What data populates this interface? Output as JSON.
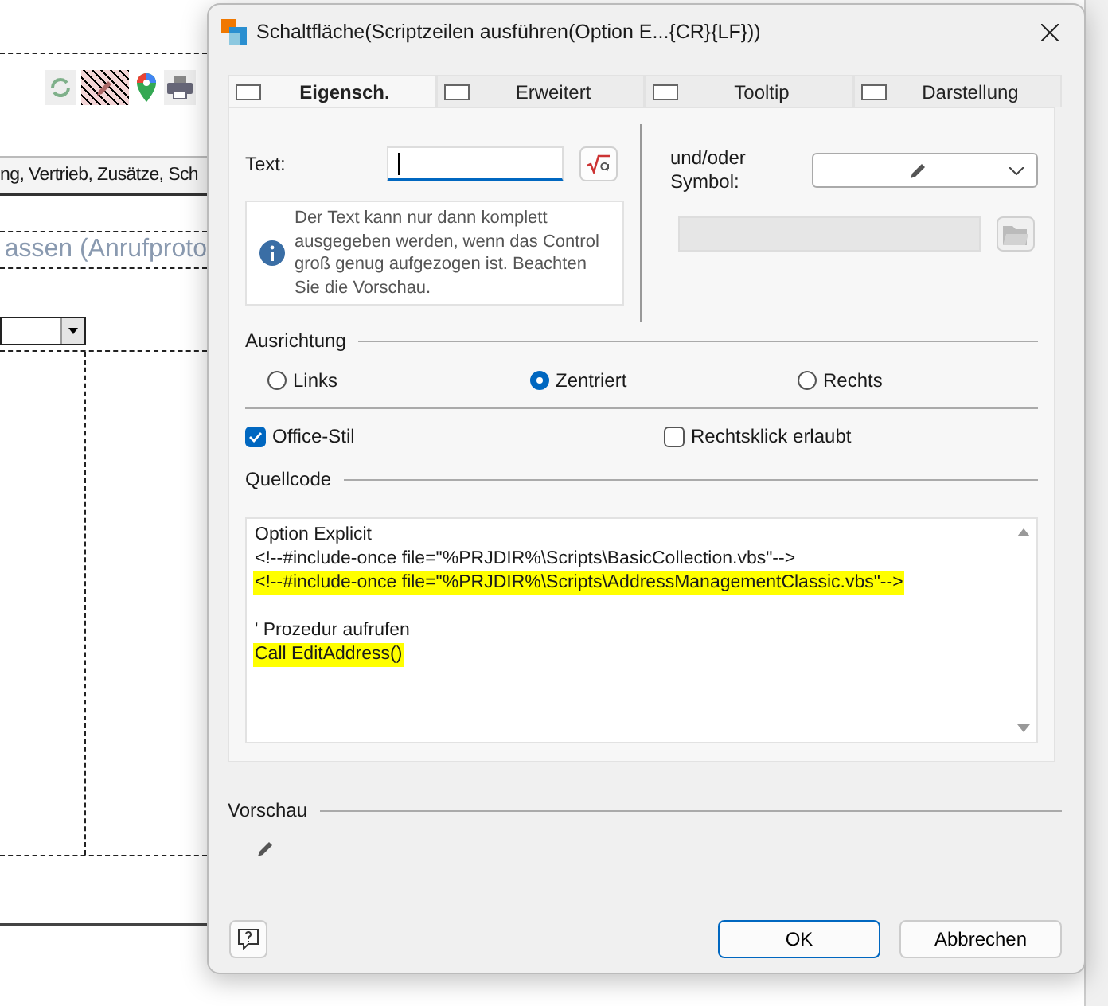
{
  "designer": {
    "tab_strip_text": "ng, Vertrieb, Zusätze, Sch",
    "heading_text": "assen (Anrufproto"
  },
  "dialog": {
    "title": "Schaltfläche(Scriptzeilen ausführen(Option E...{CR}{LF}))",
    "tabs": [
      {
        "label": "Eigensch.",
        "selected": true
      },
      {
        "label": "Erweitert",
        "selected": false
      },
      {
        "label": "Tooltip",
        "selected": false
      },
      {
        "label": "Darstellung",
        "selected": false
      }
    ],
    "text_label": "Text:",
    "symbol_label": "und/oder Symbol:",
    "info": "Der Text kann nur dann komplett ausgegeben werden, wenn das Control groß genug aufgezogen ist. Beachten Sie die Vorschau.",
    "alignment": {
      "title": "Ausrichtung",
      "options": [
        {
          "label": "Links",
          "selected": false
        },
        {
          "label": "Zentriert",
          "selected": true
        },
        {
          "label": "Rechts",
          "selected": false
        }
      ]
    },
    "checkboxes": [
      {
        "label": "Office-Stil",
        "checked": true
      },
      {
        "label": "Rechtsklick erlaubt",
        "checked": false
      }
    ],
    "source": {
      "title": "Quellcode",
      "blocks": [
        {
          "lines": [
            {
              "text": "Option Explicit",
              "highlighted": false
            },
            {
              "text": "<!--#include-once file=\"%PRJDIR%\\Scripts\\BasicCollection.vbs\"-->",
              "highlighted": false
            },
            {
              "text": "<!--#include-once file=\"%PRJDIR%\\Scripts\\AddressManagementClassic.vbs\"-->",
              "highlighted": true
            }
          ]
        },
        {
          "lines": [
            {
              "text": "' Prozedur aufrufen",
              "highlighted": false
            },
            {
              "text": "Call EditAddress()",
              "highlighted": true
            }
          ]
        }
      ]
    },
    "preview_title": "Vorschau",
    "buttons": [
      {
        "label": "OK",
        "kind": "default"
      },
      {
        "label": "Abbrechen",
        "kind": "normal"
      }
    ]
  }
}
